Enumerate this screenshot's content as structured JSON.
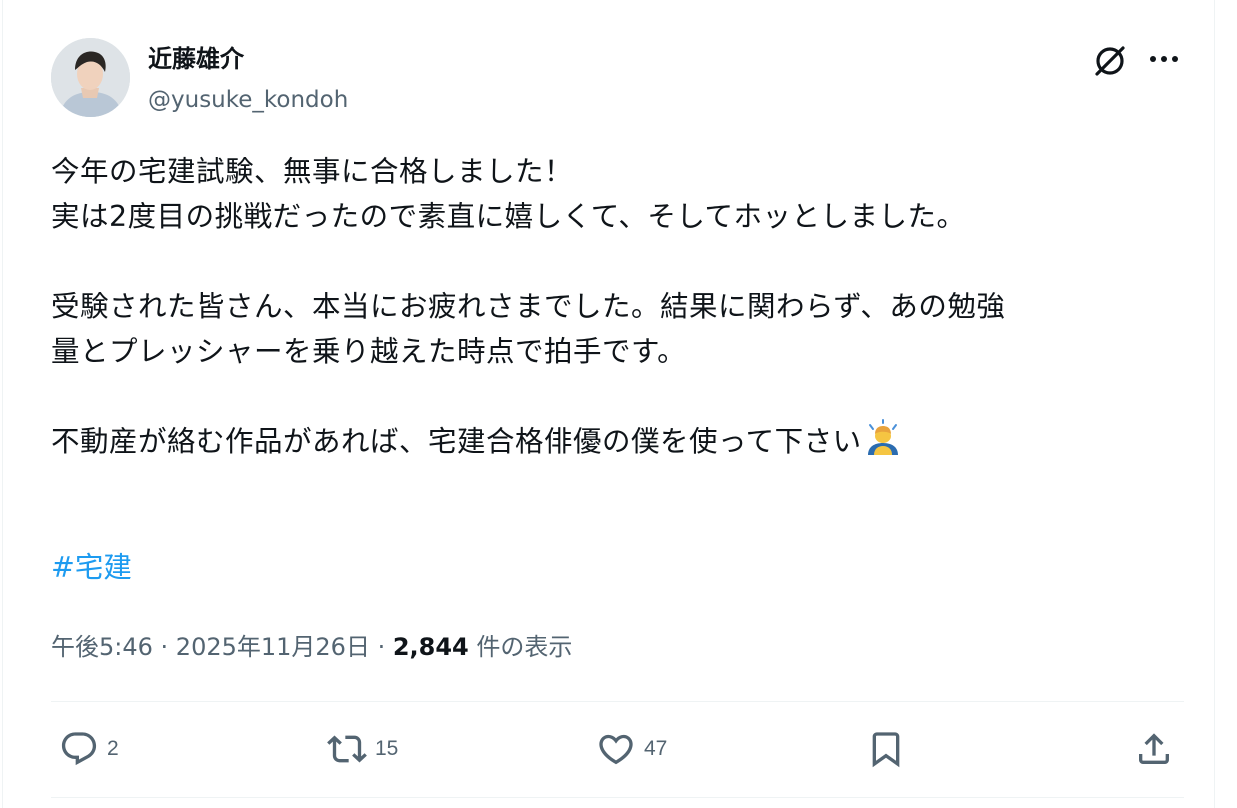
{
  "author": {
    "display_name": "近藤雄介",
    "handle": "@yusuke_kondoh"
  },
  "tweet": {
    "lines": [
      "今年の宅建試験、無事に合格しました！",
      "実は2度目の挑戦だったので素直に嬉しくて、そしてホッとしました。",
      "",
      "受験された皆さん、本当にお疲れさまでした。結果に関わらず、あの勉強",
      "量とプレッシャーを乗り越えた時点で拍手です。",
      "",
      "不動産が絡む作品があれば、宅建合格俳優の僕を使って下さい"
    ],
    "hashtag": "#宅建"
  },
  "meta": {
    "time": "午後5:46",
    "separator": " · ",
    "date": "2025年11月26日",
    "views_count": "2,844",
    "views_label": " 件の表示"
  },
  "actions": {
    "reply_count": "2",
    "retweet_count": "15",
    "like_count": "47"
  },
  "colors": {
    "text_primary": "#0f1419",
    "text_secondary": "#536471",
    "link": "#1d9bf0",
    "divider": "#eff3f4"
  },
  "icons": [
    "grok-icon",
    "more-icon",
    "reply-icon",
    "retweet-icon",
    "like-icon",
    "bookmark-icon",
    "share-icon",
    "bowing-person-emoji"
  ]
}
